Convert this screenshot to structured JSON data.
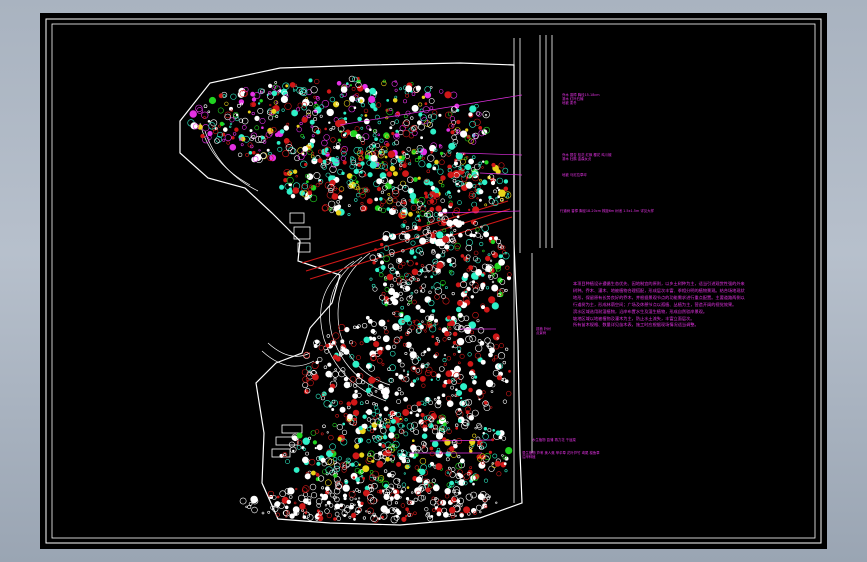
{
  "window": {
    "background_color": "#a9b3c0",
    "viewport_color": "#000000",
    "frame_color": "#ffffff"
  },
  "drawing": {
    "palette": {
      "linework": "#ffffff",
      "magenta": "#e431e4",
      "cyan": "#2ff0c8",
      "green": "#21d421",
      "red": "#d01818",
      "yellow": "#e8d21a"
    },
    "icons": [
      "plant-symbol-icon",
      "tree-symbol-icon",
      "leader-arrow-icon"
    ]
  },
  "notes": {
    "paragraphs": [
      "本项目种植设计遵循生态优先、因地制宜的原则，以乡土树种为主，适当引进观赏性强的外来树种。乔木、灌木、地被植物合理搭配，形成层次丰富、季相分明的植物景观。结合场地现状地形，保留原有长势良好的乔木，并根据景观节点的功能需求进行重点配置。主要道路两侧以行道树为主，形成林荫空间；广场及休憩节点以孤植、丛植为主，营造开阔的视觉效果。",
      "滨水区域选用耐湿植物，沿岸布置水生及湿生植物，形成自然驳岸景观。",
      "坡地区域以地被植物及灌木为主，防止水土流失，丰富立面层次。",
      "所有苗木规格、数量详见苗木表，施工时应根据现场情况适当调整。"
    ]
  },
  "callouts": [
    {
      "id": "a",
      "lines": [
        "乔木 香樟 胸径15-18cm",
        "灌木 红叶石楠",
        "地被 麦冬"
      ]
    },
    {
      "id": "b",
      "lines": [
        "乔木 银杏 桂花 红枫 樱花 鸡爪槭",
        "灌木 杜鹃 金森女贞"
      ]
    },
    {
      "id": "c",
      "lines": [
        "地被 马尼拉草坪"
      ]
    },
    {
      "id": "d",
      "lines": [
        "行道树 香樟 胸径18-20cm 株距6m 树池 1.5x1.5m 详见大样"
      ]
    },
    {
      "id": "e",
      "lines": [
        "孤植 朴树",
        "点景树"
      ]
    },
    {
      "id": "f",
      "lines": [
        "水生植物 菖蒲 再力花 千屈菜"
      ]
    },
    {
      "id": "g",
      "lines": [
        "湿生植物 芦苇 美人蕉 旱伞草 花叶芦竹 鸢尾 梭鱼草",
        "沿岸种植"
      ]
    }
  ]
}
